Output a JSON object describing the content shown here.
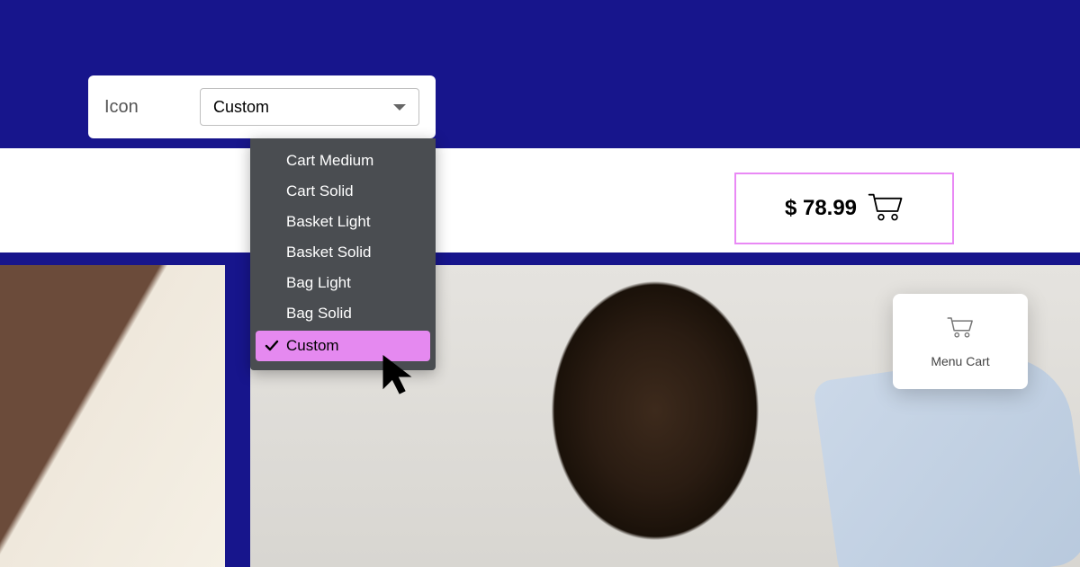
{
  "icon_panel": {
    "label": "Icon",
    "selected_value": "Custom"
  },
  "dropdown": {
    "options": [
      {
        "label": "Cart Medium",
        "selected": false
      },
      {
        "label": "Cart Solid",
        "selected": false
      },
      {
        "label": "Basket Light",
        "selected": false
      },
      {
        "label": "Basket Solid",
        "selected": false
      },
      {
        "label": "Bag Light",
        "selected": false
      },
      {
        "label": "Bag Solid",
        "selected": false
      },
      {
        "label": "Custom",
        "selected": true
      }
    ]
  },
  "cart_total": {
    "price": "$ 78.99"
  },
  "menu_cart": {
    "label": "Menu Cart"
  }
}
